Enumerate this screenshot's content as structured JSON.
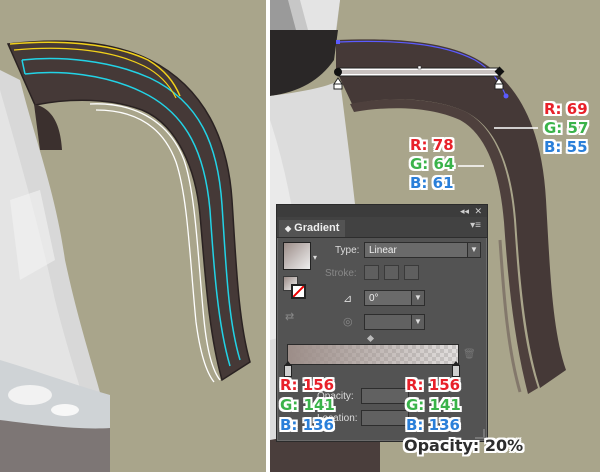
{
  "left_readouts": [],
  "right_readouts": {
    "top": {
      "r": "R: 69",
      "g": "G: 57",
      "b": "B: 55"
    },
    "middle": {
      "r": "R: 78",
      "g": "G: 64",
      "b": "B: 61"
    }
  },
  "stop_readouts": {
    "left": {
      "r": "R: 156",
      "g": "G: 141",
      "b": "B: 136"
    },
    "right": {
      "r": "R: 156",
      "g": "G: 141",
      "b": "B: 136"
    }
  },
  "opacity_note": "Opacity: 20%",
  "gradient_panel": {
    "tab_label": "Gradient",
    "type_label": "Type:",
    "type_value": "Linear",
    "stroke_label": "Stroke:",
    "angle_value": "0°",
    "aspect_value": "",
    "opacity_label": "Opacity:",
    "location_label": "Location:",
    "collapse_icon": "double-chevron",
    "close_icon": "x"
  },
  "colors": {
    "handle_dark": "#453937",
    "handle_mid": "#4e403d",
    "stop_color": "#9c8d88",
    "guide_cyan": "#22d3e6",
    "guide_yellow": "#f2d11a",
    "selection_blue": "#5b5bff"
  }
}
